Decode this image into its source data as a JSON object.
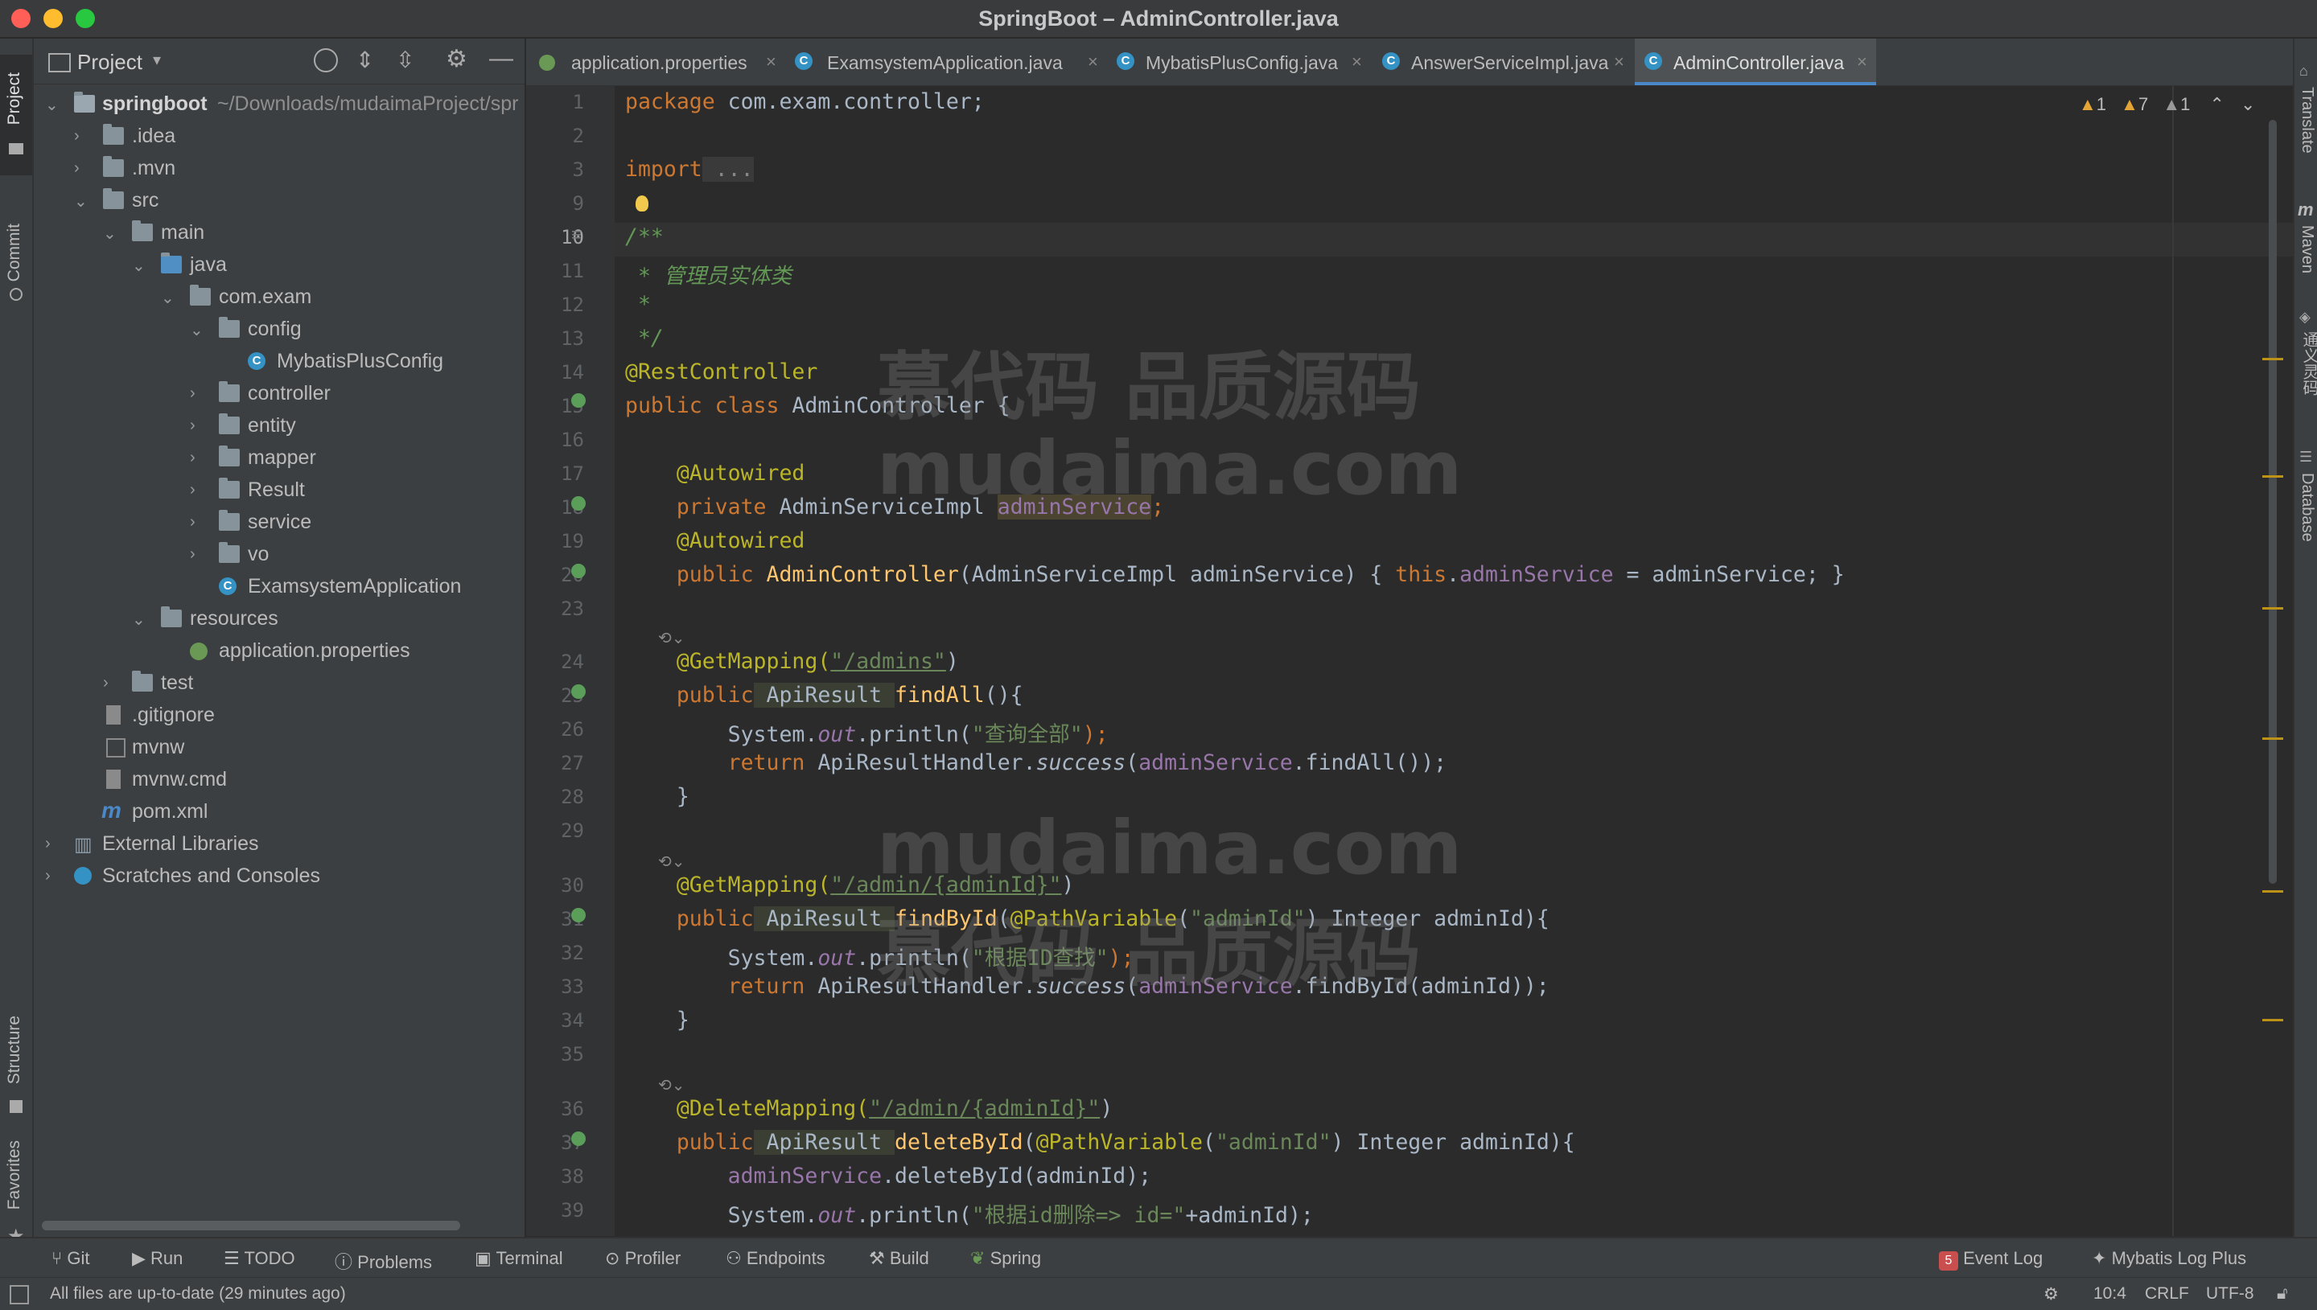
{
  "window": {
    "title": "SpringBoot – AdminController.java"
  },
  "left_strip": {
    "project": "Project",
    "commit": "Commit",
    "structure": "Structure",
    "favorites": "Favorites"
  },
  "project_panel": {
    "header": "Project",
    "tree": [
      {
        "label": "springboot",
        "suffix": "~/Downloads/mudaimaProject/spr"
      },
      {
        "label": ".idea"
      },
      {
        "label": ".mvn"
      },
      {
        "label": "src"
      },
      {
        "label": "main"
      },
      {
        "label": "java"
      },
      {
        "label": "com.exam"
      },
      {
        "label": "config"
      },
      {
        "label": "MybatisPlusConfig"
      },
      {
        "label": "controller"
      },
      {
        "label": "entity"
      },
      {
        "label": "mapper"
      },
      {
        "label": "Result"
      },
      {
        "label": "service"
      },
      {
        "label": "vo"
      },
      {
        "label": "ExamsystemApplication"
      },
      {
        "label": "resources"
      },
      {
        "label": "application.properties"
      },
      {
        "label": "test"
      },
      {
        "label": ".gitignore"
      },
      {
        "label": "mvnw"
      },
      {
        "label": "mvnw.cmd"
      },
      {
        "label": "pom.xml"
      },
      {
        "label": "External Libraries"
      },
      {
        "label": "Scratches and Consoles"
      }
    ]
  },
  "tabs": [
    {
      "label": "application.properties"
    },
    {
      "label": "ExamsystemApplication.java"
    },
    {
      "label": "MybatisPlusConfig.java"
    },
    {
      "label": "AnswerServiceImpl.java"
    },
    {
      "label": "AdminController.java"
    }
  ],
  "editor": {
    "inspections": {
      "warn1": "1",
      "warn2": "7",
      "warn3": "1"
    },
    "line_numbers": [
      "1",
      "2",
      "3",
      "9",
      "10",
      "11",
      "12",
      "13",
      "14",
      "15",
      "16",
      "17",
      "18",
      "19",
      "20",
      "23",
      "24",
      "25",
      "26",
      "27",
      "28",
      "29",
      "30",
      "31",
      "32",
      "33",
      "34",
      "35",
      "36",
      "37",
      "38",
      "39"
    ],
    "code": {
      "l1a": "package",
      "l1b": " com.exam.controller;",
      "l3a": "import",
      "l3b": " ...",
      "l10": "/**",
      "l11": " * 管理员实体类",
      "l12": " *",
      "l13": " */",
      "l14": "@RestController",
      "l15a": "public class",
      "l15b": " AdminController {",
      "l17": "    @Autowired",
      "l18a": "    private",
      "l18b": " AdminServiceImpl ",
      "l18c": "adminService",
      "l18d": ";",
      "l19": "    @Autowired",
      "l20a": "    public",
      "l20b": " AdminController",
      "l20c": "(AdminServiceImpl adminService) { ",
      "l20d": "this",
      "l20e": ".",
      "l20f": "adminService",
      "l20g": " = adminService; }",
      "l24a": "    @GetMapping(",
      "l24b": "\"/admins\"",
      "l24c": ")",
      "l25a": "    public",
      "l25b": " ApiResult ",
      "l25c": "findAll",
      "l25d": "(){",
      "l26a": "        System.",
      "l26b": "out",
      "l26c": ".println(",
      "l26d": "\"查询全部\"",
      "l26e": ");",
      "l27a": "        return",
      "l27b": " ApiResultHandler.",
      "l27c": "success",
      "l27d": "(",
      "l27e": "adminService",
      "l27f": ".findAll());",
      "l28": "    }",
      "l30a": "    @GetMapping(",
      "l30b": "\"/admin/{adminId}\"",
      "l30c": ")",
      "l31a": "    public",
      "l31b": " ApiResult ",
      "l31c": "findById",
      "l31d": "(",
      "l31e": "@PathVariable",
      "l31f": "(",
      "l31g": "\"adminId\"",
      "l31h": ") Integer adminId){",
      "l32a": "        System.",
      "l32b": "out",
      "l32c": ".println(",
      "l32d": "\"根据ID查找\"",
      "l32e": ");",
      "l33a": "        return",
      "l33b": " ApiResultHandler.",
      "l33c": "success",
      "l33d": "(",
      "l33e": "adminService",
      "l33f": ".findById(adminId));",
      "l34": "    }",
      "l36a": "    @DeleteMapping(",
      "l36b": "\"/admin/{adminId}\"",
      "l36c": ")",
      "l37a": "    public",
      "l37b": " ApiResult ",
      "l37c": "deleteById",
      "l37d": "(",
      "l37e": "@PathVariable",
      "l37f": "(",
      "l37g": "\"adminId\"",
      "l37h": ") Integer adminId){",
      "l38a": "        ",
      "l38b": "adminService",
      "l38c": ".deleteById(adminId);",
      "l39a": "        System.",
      "l39b": "out",
      "l39c": ".println(",
      "l39d": "\"根据id删除=> id=\"",
      "l39e": "+adminId);"
    },
    "watermarks": [
      "慕代码 品质源码",
      "mudaima.com",
      "mudaima.com",
      "慕代码 品质源码"
    ]
  },
  "right_strip": {
    "translate": "Translate",
    "maven": "Maven",
    "tongyi": "通义灵码",
    "database": "Database"
  },
  "bottom_tools": {
    "git": "Git",
    "run": "Run",
    "todo": "TODO",
    "problems": "Problems",
    "terminal": "Terminal",
    "profiler": "Profiler",
    "endpoints": "Endpoints",
    "build": "Build",
    "spring": "Spring",
    "event_log": "Event Log",
    "event_count": "5",
    "mybatis": "Mybatis Log Plus"
  },
  "status": {
    "message": "All files are up-to-date (29 minutes ago)",
    "position": "10:4",
    "line_sep": "CRLF",
    "encoding": "UTF-8"
  }
}
